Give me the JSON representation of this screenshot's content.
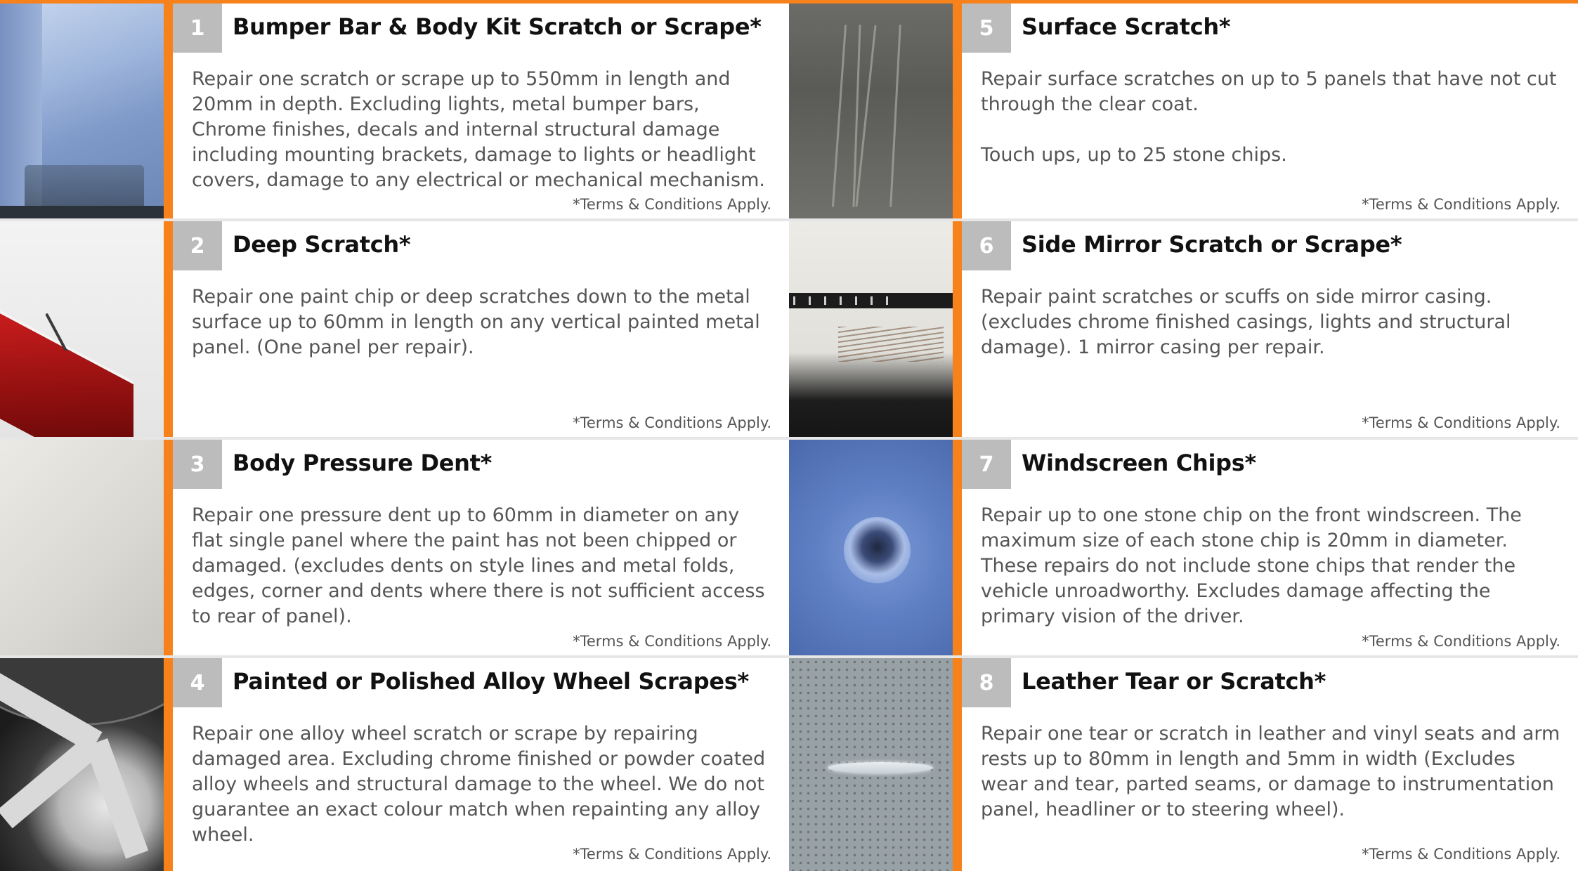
{
  "terms_text": "*Terms & Conditions Apply.",
  "accent_color": "#f7821b",
  "badge_color": "#bcbcbc",
  "cards": [
    {
      "number": "1",
      "title": "Bumper Bar & Body Kit Scratch or Scrape*",
      "description": "Repair one scratch or scrape up to 550mm in length and 20mm in depth. Excluding lights, metal bumper bars, Chrome finishes, decals and internal structural damage including mounting brackets, damage to lights or headlight covers, damage to any electrical or mechanical mechanism.",
      "image": "blue-bumper-photo"
    },
    {
      "number": "5",
      "title": "Surface Scratch*",
      "description": "Repair surface scratches on up to 5 panels that have not cut through the clear coat.\n\nTouch ups, up to 25 stone chips.",
      "image": "grey-panel-scratch-photo"
    },
    {
      "number": "2",
      "title": "Deep Scratch*",
      "description": "Repair one paint chip or deep scratches down to the metal surface up to 60mm in length on any vertical painted metal panel. (One panel per repair).",
      "image": "white-panel-tail-light-photo"
    },
    {
      "number": "6",
      "title": "Side Mirror Scratch or Scrape*",
      "description": "Repair paint scratches or scuffs on side mirror casing. (excludes chrome finished casings, lights and structural damage). 1 mirror casing per repair.",
      "image": "side-mirror-photo"
    },
    {
      "number": "3",
      "title": "Body Pressure Dent*",
      "description": "Repair one pressure dent up to 60mm in diameter on any flat single panel where the paint has not been chipped or damaged. (excludes dents on style lines and metal folds, edges, corner and dents where there is not sufficient access to rear of panel).",
      "image": "white-door-dent-photo"
    },
    {
      "number": "7",
      "title": "Windscreen Chips*",
      "description": "Repair up to one stone chip on the front windscreen. The maximum size of each stone chip is 20mm in diameter. These repairs do not include stone chips that render the vehicle unroadworthy. Excludes damage affecting the primary vision of the driver.",
      "image": "windscreen-chip-photo"
    },
    {
      "number": "4",
      "title": "Painted or Polished Alloy Wheel Scrapes*",
      "description": "Repair one alloy wheel scratch or scrape by repairing damaged area. Excluding chrome finished or powder coated alloy wheels and structural damage to the wheel. We do not guarantee an exact colour match when repainting any alloy wheel.",
      "image": "alloy-wheel-photo"
    },
    {
      "number": "8",
      "title": "Leather Tear or Scratch*",
      "description": "Repair one tear or scratch in leather and vinyl seats and arm rests up to 80mm in length and 5mm in width (Excludes wear and tear, parted seams, or damage to instrumentation panel, headliner or to steering wheel).",
      "image": "leather-seat-tear-photo"
    }
  ]
}
